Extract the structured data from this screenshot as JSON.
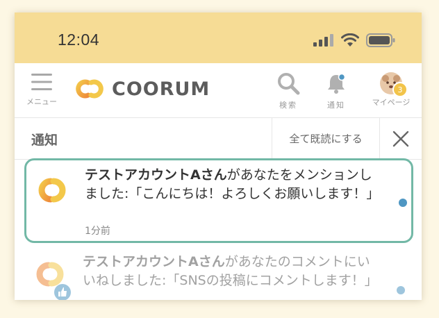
{
  "status": {
    "time": "12:04"
  },
  "header": {
    "menu_label": "メニュー",
    "logo_text": "COORUM",
    "search_label": "検索",
    "notify_label": "通知",
    "mypage_label": "マイページ",
    "mypage_badge": "3"
  },
  "subbar": {
    "title": "通知",
    "mark_all_read": "全て既読にする"
  },
  "notifications": [
    {
      "actor": "テストアカウントAさん",
      "message": "があなたをメンションしました:「こんにちは！よろしくお願いします！」",
      "time": "1分前",
      "unread": true
    },
    {
      "actor": "テストアカウントAさん",
      "message": "があなたのコメントにいいねしました:「SNSの投稿にコメントします！」",
      "unread": true
    }
  ],
  "colors": {
    "statusbar": "#f6dc95",
    "accent_border": "#72b8a6",
    "unread_dot": "#4f97c3",
    "logo_orange": "#ee8a3a",
    "logo_yellow": "#f3c84a"
  }
}
